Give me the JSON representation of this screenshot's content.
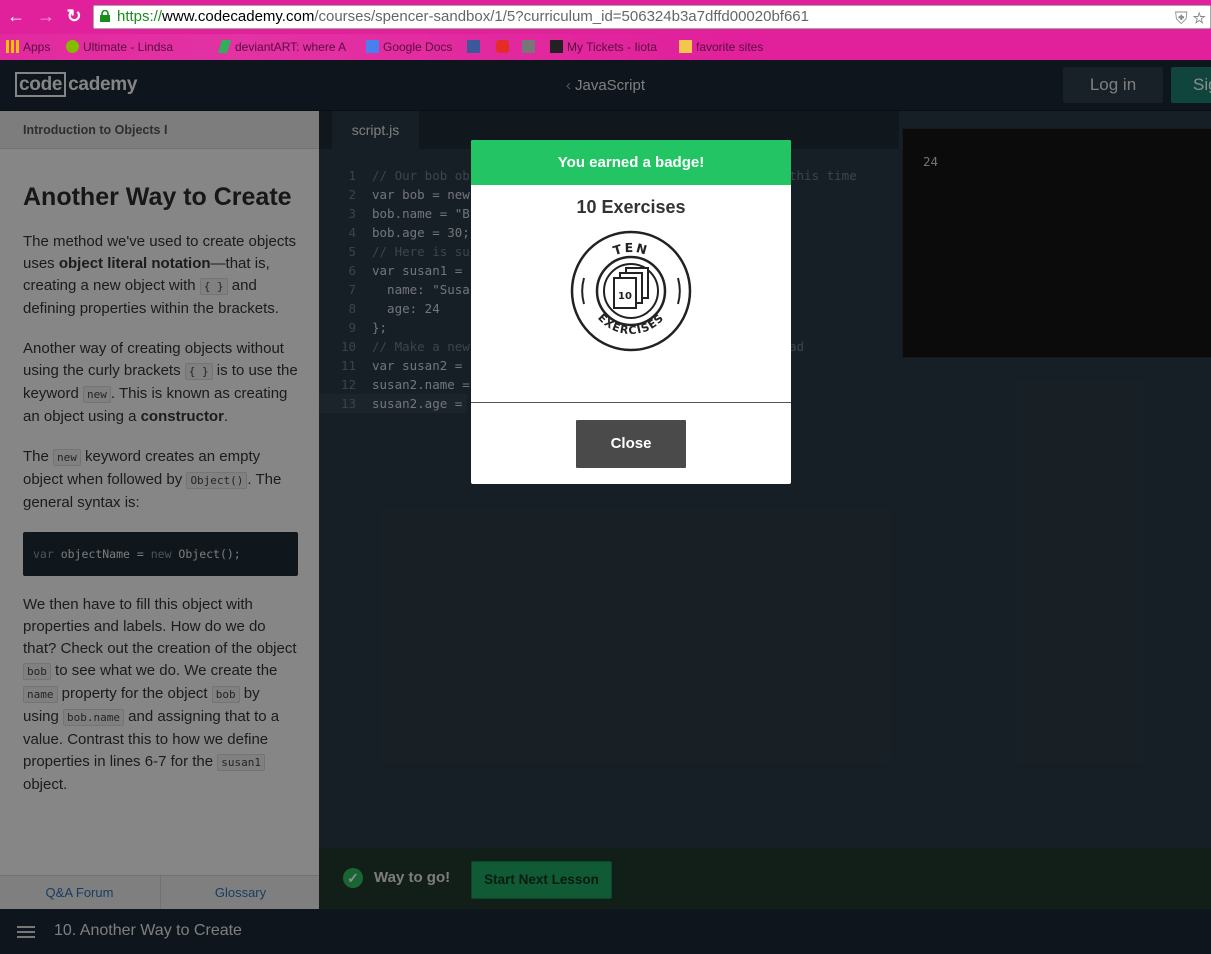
{
  "browser": {
    "url_scheme": "https://",
    "url_host": "www.codecademy.com",
    "url_path": "/courses/spencer-sandbox/1/5?curriculum_id=506324b3a7dffd00020bf661",
    "bookmarks": [
      {
        "label": "Apps",
        "icon": "apps-grid-icon"
      },
      {
        "label": "Ultimate - Lindsa",
        "icon": "spotify-icon"
      },
      {
        "label": "deviantART: where A",
        "icon": "deviantart-icon"
      },
      {
        "label": "Google Docs",
        "icon": "google-docs-icon"
      },
      {
        "label": "",
        "icon": "facebook-icon"
      },
      {
        "label": "",
        "icon": "youtube-icon"
      },
      {
        "label": "",
        "icon": "building-icon"
      },
      {
        "label": "My Tickets - Iiota",
        "icon": "ticket-icon"
      },
      {
        "label": "favorite sites",
        "icon": "folder-icon"
      }
    ]
  },
  "header": {
    "logo_box": "code",
    "logo_rest": "cademy",
    "course_title": "JavaScript",
    "login_label": "Log in",
    "signup_label": "Sig"
  },
  "lesson": {
    "section_title": "Introduction to Objects I",
    "heading": "Another Way to Create",
    "p1_a": "The method we've used to create objects uses ",
    "p1_bold": "object literal notation",
    "p1_b": "—that is, creating a new object with ",
    "p1_code": "{ }",
    "p1_c": " and defining properties within the brackets.",
    "p2_a": "Another way of creating objects without using the curly brackets ",
    "p2_code1": "{ }",
    "p2_b": " is to use the keyword ",
    "p2_code2": "new",
    "p2_c": ". This is known as creating an object using a ",
    "p2_bold": "constructor",
    "p2_d": ".",
    "p3_a": "The ",
    "p3_code1": "new",
    "p3_b": " keyword creates an empty object when followed by ",
    "p3_code2": "Object()",
    "p3_c": ". The general syntax is:",
    "code_kw": "var",
    "code_rest_a": " objectName = ",
    "code_kw2": "new",
    "code_rest_b": " Object();",
    "p4_a": "We then have to fill this object with properties and labels. How do we do that? Check out the creation of the object ",
    "p4_code1": "bob",
    "p4_b": " to see what we do. We create the ",
    "p4_code2": "name",
    "p4_c": " property for the object ",
    "p4_code3": "bob",
    "p4_d": " by using ",
    "p4_code4": "bob.name",
    "p4_e": " and assigning that to a value. Contrast this to how we define properties in lines 6-7 for the ",
    "p4_code5": "susan1",
    "p4_f": " object.",
    "footer_left": "Q&A Forum",
    "footer_right": "Glossary"
  },
  "editor": {
    "tab_label": "script.js",
    "lines": [
      {
        "n": "1",
        "a": "// Our bob ob"
      },
      {
        "n": "2",
        "a": "var bob = new"
      },
      {
        "n": "3",
        "a": "bob.name = \"B"
      },
      {
        "n": "4",
        "a": "bob.age = 30;"
      },
      {
        "n": "5",
        "a": "// Here is su"
      },
      {
        "n": "6",
        "a": "var susan1 = "
      },
      {
        "n": "7",
        "a": "  name: \"Susa"
      },
      {
        "n": "8",
        "a": "  age: 24"
      },
      {
        "n": "9",
        "a": "};"
      },
      {
        "n": "10",
        "a": "// Make a new"
      },
      {
        "n": "11",
        "a": "var susan2 = "
      },
      {
        "n": "12",
        "a": "susan2.name ="
      },
      {
        "n": "13",
        "a": "susan2.age ="
      }
    ],
    "right_frag_1": "this time",
    "right_frag_10": "ad"
  },
  "console": {
    "output": "24"
  },
  "success": {
    "message": "Way to go!",
    "next_button": "Start Next Lesson"
  },
  "bottom_nav": {
    "lesson_title": "10. Another Way to Create"
  },
  "modal": {
    "header": "You earned a badge!",
    "badge_name": "10 Exercises",
    "badge_top_text": "TEN",
    "badge_bottom_text": "EXERCISES",
    "badge_number": "10",
    "close_label": "Close"
  },
  "colors": {
    "browser_chrome": "#e0219b",
    "header_bg": "#1a2733",
    "modal_header": "#23c464",
    "success_button": "#1ea562"
  }
}
